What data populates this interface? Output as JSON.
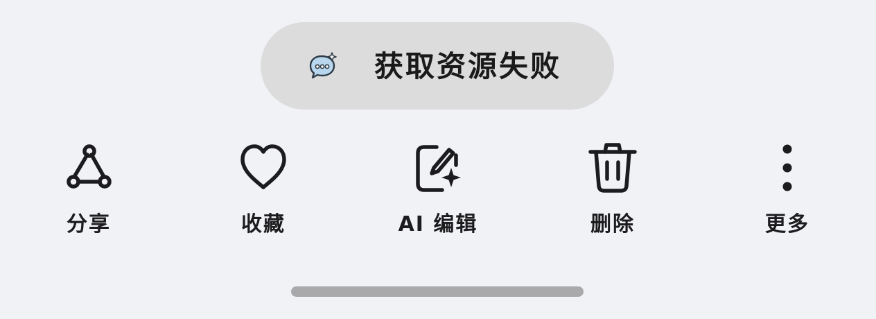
{
  "toast": {
    "icon": "chat-bubble-sparkle-icon",
    "message": "获取资源失败"
  },
  "actions": [
    {
      "icon": "share-icon",
      "label": "分享"
    },
    {
      "icon": "heart-icon",
      "label": "收藏"
    },
    {
      "icon": "ai-edit-icon",
      "label": "AI 编辑"
    },
    {
      "icon": "trash-icon",
      "label": "删除"
    },
    {
      "icon": "more-vertical-icon",
      "label": "更多"
    }
  ],
  "colors": {
    "background": "#f1f2f6",
    "toast_background": "#dcdcdd",
    "text": "#1c1c1e",
    "home_indicator": "#a9a9ab"
  }
}
